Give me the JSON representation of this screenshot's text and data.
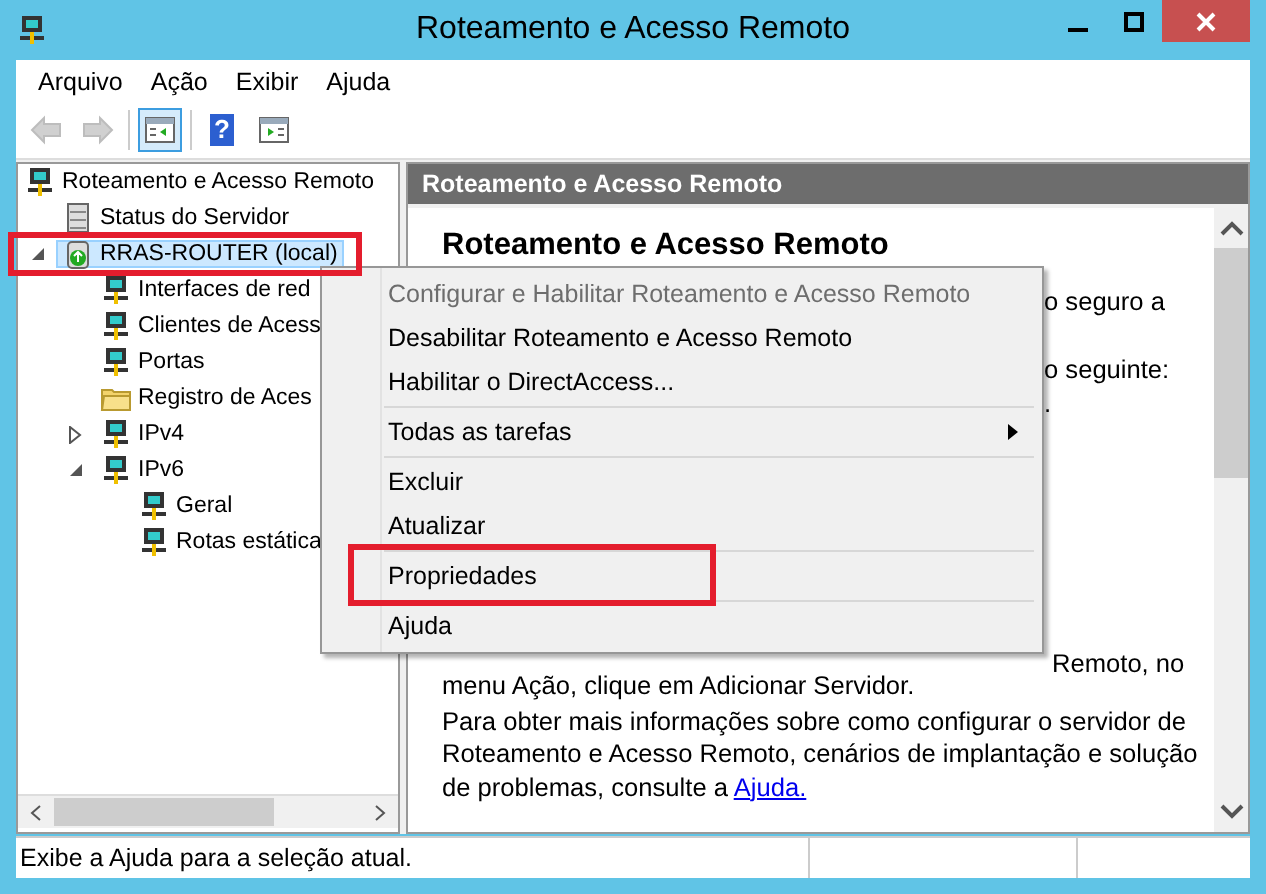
{
  "window": {
    "title": "Roteamento e Acesso Remoto"
  },
  "menu_bar": [
    "Arquivo",
    "Ação",
    "Exibir",
    "Ajuda"
  ],
  "toolbar": [
    {
      "kind": "back",
      "disabled": true,
      "pressed": false
    },
    {
      "kind": "forward",
      "disabled": true,
      "pressed": false
    },
    {
      "kind": "tree",
      "disabled": false,
      "pressed": true
    },
    {
      "kind": "help",
      "glyph": "?",
      "disabled": false,
      "pressed": false
    },
    {
      "kind": "action-pane",
      "disabled": false,
      "pressed": false
    }
  ],
  "tree": [
    {
      "label": "Roteamento e Acesso Remoto",
      "kind": "computer",
      "selected": false,
      "children": [
        {
          "label": "Status do Servidor",
          "kind": "server",
          "selected": false
        },
        {
          "label": "RRAS-ROUTER (local)",
          "kind": "router",
          "selected": true,
          "expanded": true,
          "highlighted": true,
          "children": [
            {
              "label": "Interfaces de red",
              "kind": "computer",
              "selected": false
            },
            {
              "label": "Clientes de Acess",
              "kind": "computer",
              "selected": false
            },
            {
              "label": "Portas",
              "kind": "computer",
              "selected": false
            },
            {
              "label": "Registro de Aces",
              "kind": "folder",
              "selected": false
            },
            {
              "label": "IPv4",
              "kind": "computer",
              "selected": false,
              "expanded": false
            },
            {
              "label": "IPv6",
              "kind": "computer",
              "selected": false,
              "expanded": true,
              "children": [
                {
                  "label": "Geral",
                  "kind": "computer",
                  "selected": false
                },
                {
                  "label": "Rotas estática",
                  "kind": "computer",
                  "selected": false
                }
              ]
            }
          ]
        }
      ]
    }
  ],
  "details": {
    "header": "Roteamento e Acesso Remoto",
    "heading": "Roteamento e Acesso Remoto",
    "fragments": [
      "o seguro a",
      "o seguinte:",
      ".",
      "Remoto, no"
    ],
    "paragraphs": [
      {
        "text": "menu Ação, clique em Adicionar Servidor."
      },
      {
        "text": "Para obter mais informações sobre como configurar o servidor de Roteamento e Acesso Remoto, cenários de implantação e solução de problemas, consulte a",
        "link": "Ajuda."
      }
    ]
  },
  "context_menu": [
    {
      "kind": "item",
      "label": "Configurar e Habilitar Roteamento e Acesso Remoto",
      "disabled": true
    },
    {
      "kind": "item",
      "label": "Desabilitar Roteamento e Acesso Remoto",
      "disabled": false
    },
    {
      "kind": "item",
      "label": "Habilitar o DirectAccess...",
      "disabled": false
    },
    {
      "kind": "separator"
    },
    {
      "kind": "submenu",
      "label": "Todas as tarefas",
      "disabled": false
    },
    {
      "kind": "separator"
    },
    {
      "kind": "item",
      "label": "Excluir",
      "disabled": false
    },
    {
      "kind": "item",
      "label": "Atualizar",
      "disabled": false
    },
    {
      "kind": "separator"
    },
    {
      "kind": "item",
      "label": "Propriedades",
      "disabled": false,
      "highlighted": true
    },
    {
      "kind": "separator"
    },
    {
      "kind": "item",
      "label": "Ajuda",
      "disabled": false
    }
  ],
  "status_bar": {
    "text": "Exibe a Ajuda para a seleção atual."
  }
}
